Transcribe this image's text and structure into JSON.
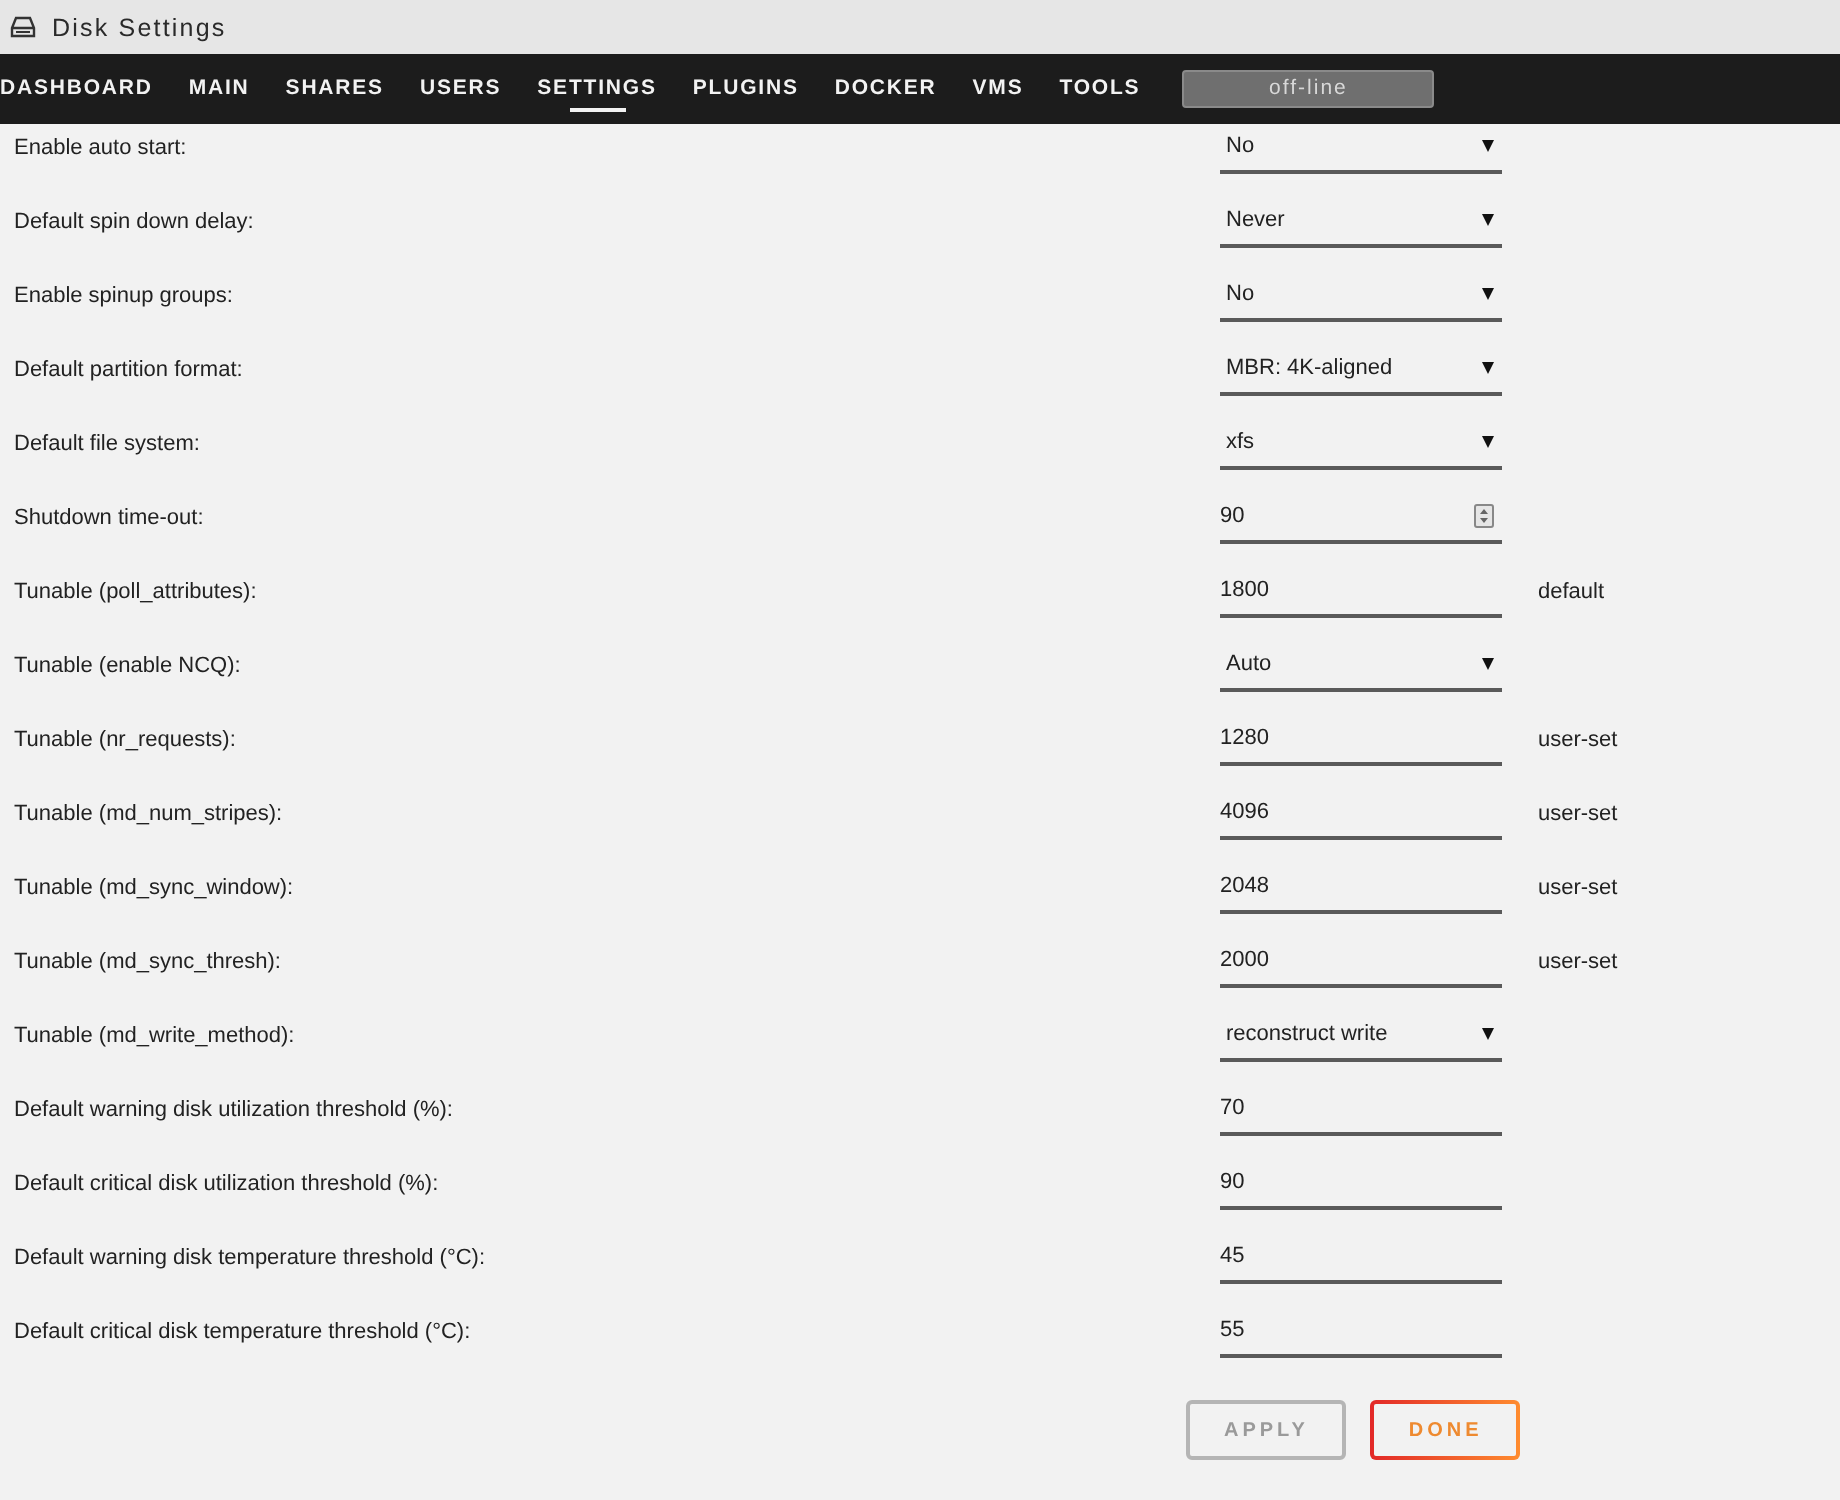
{
  "window": {
    "title": "Disk Settings"
  },
  "nav": {
    "tabs": [
      {
        "label": "DASHBOARD",
        "selected": false
      },
      {
        "label": "MAIN",
        "selected": false
      },
      {
        "label": "SHARES",
        "selected": false
      },
      {
        "label": "USERS",
        "selected": false
      },
      {
        "label": "SETTINGS",
        "selected": true
      },
      {
        "label": "PLUGINS",
        "selected": false
      },
      {
        "label": "DOCKER",
        "selected": false
      },
      {
        "label": "VMS",
        "selected": false
      },
      {
        "label": "TOOLS",
        "selected": false
      }
    ],
    "status": "off-line"
  },
  "settings": [
    {
      "label": "Enable auto start:",
      "kind": "select",
      "value": "No"
    },
    {
      "label": "Default spin down delay:",
      "kind": "select",
      "value": "Never"
    },
    {
      "label": "Enable spinup groups:",
      "kind": "select",
      "value": "No"
    },
    {
      "label": "Default partition format:",
      "kind": "select",
      "value": "MBR: 4K-aligned"
    },
    {
      "label": "Default file system:",
      "kind": "select",
      "value": "xfs"
    },
    {
      "label": "Shutdown time-out:",
      "kind": "number",
      "value": "90"
    },
    {
      "label": "Tunable (poll_attributes):",
      "kind": "text",
      "value": "1800",
      "note": "default"
    },
    {
      "label": "Tunable (enable NCQ):",
      "kind": "select",
      "value": "Auto"
    },
    {
      "label": "Tunable (nr_requests):",
      "kind": "text",
      "value": "1280",
      "note": "user-set"
    },
    {
      "label": "Tunable (md_num_stripes):",
      "kind": "text",
      "value": "4096",
      "note": "user-set"
    },
    {
      "label": "Tunable (md_sync_window):",
      "kind": "text",
      "value": "2048",
      "note": "user-set"
    },
    {
      "label": "Tunable (md_sync_thresh):",
      "kind": "text",
      "value": "2000",
      "note": "user-set"
    },
    {
      "label": "Tunable (md_write_method):",
      "kind": "select",
      "value": "reconstruct write"
    },
    {
      "label": "Default warning disk utilization threshold (%):",
      "kind": "text",
      "value": "70"
    },
    {
      "label": "Default critical disk utilization threshold (%):",
      "kind": "text",
      "value": "90"
    },
    {
      "label": "Default warning disk temperature threshold (°C):",
      "kind": "text",
      "value": "45"
    },
    {
      "label": "Default critical disk temperature threshold (°C):",
      "kind": "text",
      "value": "55"
    }
  ],
  "buttons": [
    {
      "label": "APPLY",
      "disabled": true
    },
    {
      "label": "DONE",
      "disabled": false
    }
  ]
}
